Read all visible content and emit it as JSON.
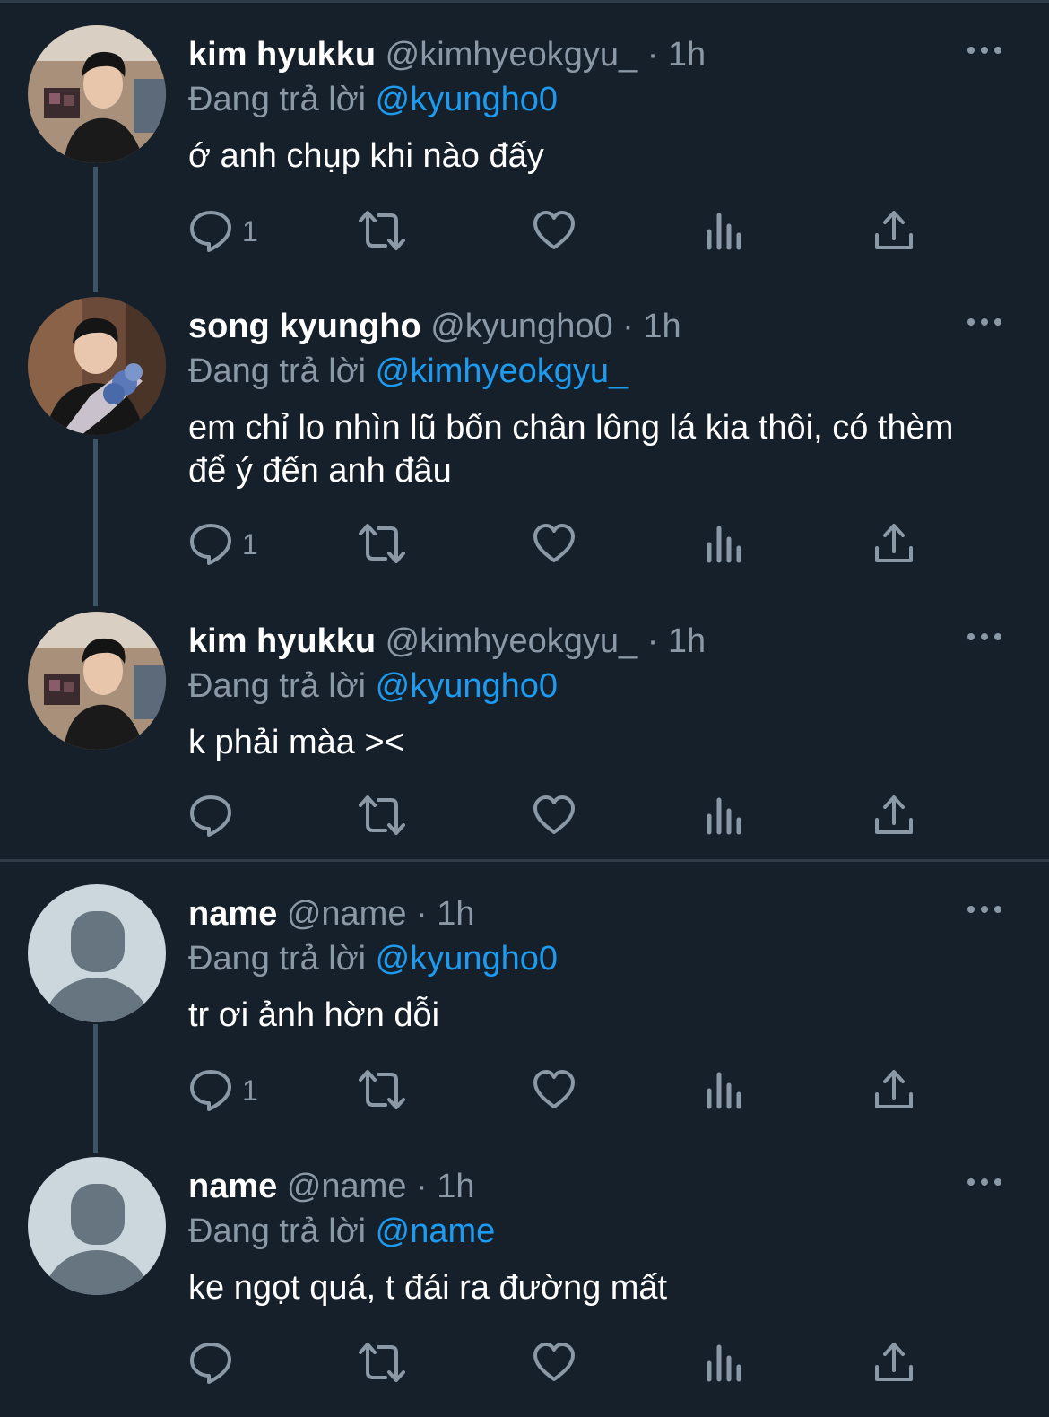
{
  "reply_prefix": "Đang trả lời",
  "colors": {
    "background": "#15202b",
    "mention": "#1d9bf0",
    "muted": "#8b98a5",
    "divider": "#2f3c48"
  },
  "icons": [
    "reply-icon",
    "retweet-icon",
    "like-icon",
    "views-icon",
    "share-icon",
    "more-icon"
  ],
  "tweets": [
    {
      "name": "kim hyukku",
      "handle": "@kimhyeokgyu_",
      "dot": "·",
      "time": "1h",
      "replying_to": "@kyungho0",
      "text": "ớ anh chụp khi nào đấy",
      "reply_count": "1",
      "avatar": "photo-man-dark-hoodie"
    },
    {
      "name": "song kyungho",
      "handle": "@kyungho0",
      "dot": "·",
      "time": "1h",
      "replying_to": "@kimhyeokgyu_",
      "text": "em chỉ lo nhìn lũ bốn chân lông lá kia thôi, có thèm để ý đến anh đâu",
      "reply_count": "1",
      "avatar": "photo-man-with-flowers"
    },
    {
      "name": "kim hyukku",
      "handle": "@kimhyeokgyu_",
      "dot": "·",
      "time": "1h",
      "replying_to": "@kyungho0",
      "text": "k phải màa ><",
      "reply_count": "",
      "avatar": "photo-man-dark-hoodie"
    },
    {
      "name": "name",
      "handle": "@name",
      "dot": "·",
      "time": "1h",
      "replying_to": "@kyungho0",
      "text": "tr ơi ảnh hờn dỗi",
      "reply_count": "1",
      "avatar": "default-profile"
    },
    {
      "name": "name",
      "handle": "@name",
      "dot": "·",
      "time": "1h",
      "replying_to": "@name",
      "text": "ke ngọt quá, t đái ra đường mất",
      "reply_count": "",
      "avatar": "default-profile"
    }
  ]
}
